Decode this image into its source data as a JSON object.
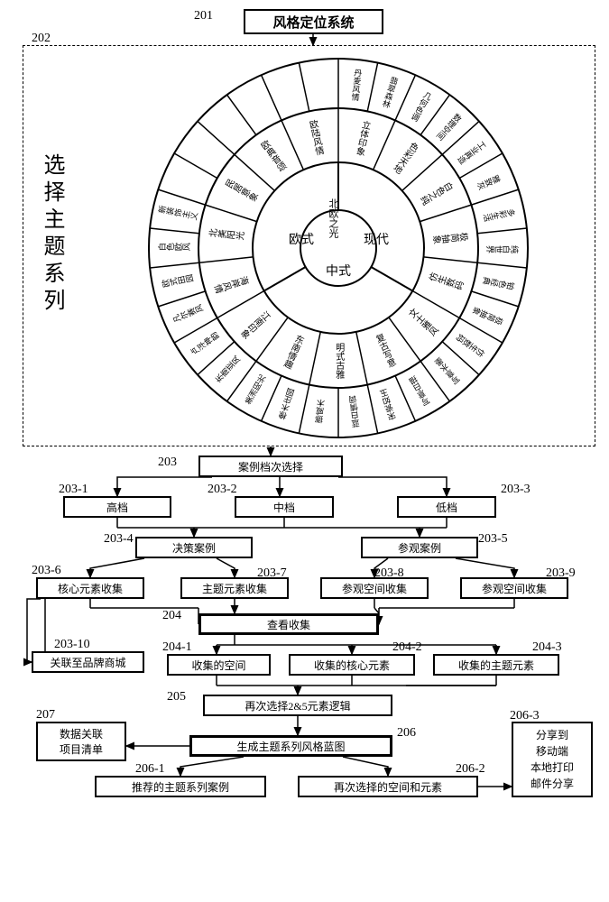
{
  "refs": {
    "r201": "201",
    "r202": "202",
    "r203": "203",
    "r203_1": "203-1",
    "r203_2": "203-2",
    "r203_3": "203-3",
    "r203_4": "203-4",
    "r203_5": "203-5",
    "r203_6": "203-6",
    "r203_7": "203-7",
    "r203_8": "203-8",
    "r203_9": "203-9",
    "r203_10": "203-10",
    "r204": "204",
    "r204_1": "204-1",
    "r204_2": "204-2",
    "r204_3": "204-3",
    "r205": "205",
    "r206": "206",
    "r206_1": "206-1",
    "r206_2": "206-2",
    "r206_3": "206-3",
    "r207": "207"
  },
  "title": "风格定位系统",
  "panel_title": "选择主题系列",
  "sunburst": {
    "center_top": "北欧之光",
    "ring1": [
      "欧式",
      "现代",
      "中式"
    ],
    "ring2_eu": [
      "欧陆风情",
      "欧典音颂",
      "民居意象",
      "北美阳光",
      "海岸风情"
    ],
    "ring2_modern": [
      "立体印象",
      "色彩天地",
      "白色之纯",
      "极简抽象",
      "仿生数码"
    ],
    "ring2_cn": [
      "文士雅风",
      "复古写意",
      "明式古雅",
      "东南情趣",
      "江南印象"
    ],
    "ring3_eu": [
      "新装饰主义",
      "白色欧风",
      "欧式田园",
      "凡尔赛风",
      "卢浮神韵",
      "东南亚风",
      "美洲阳光",
      "橡木庄园",
      "挪威木",
      "蓝白情调"
    ],
    "ring3_modern": [
      "丹麦风情",
      "翡翠森林",
      "几何色调",
      "数理空间",
      "工业再造",
      "雅致灰",
      "多彩生活",
      "纯白世界",
      "铂色经典",
      "极简抽象",
      "仿生数码"
    ],
    "ring3_cn": [
      "写意水墨",
      "写意白描",
      "宋瓷如玉"
    ]
  },
  "flow": {
    "case_grade_select": "案例档次选择",
    "grade_high": "高档",
    "grade_mid": "中档",
    "grade_low": "低档",
    "decision_case": "决策案例",
    "visit_case": "参观案例",
    "core_elem_collect": "核心元素收集",
    "theme_elem_collect": "主题元素收集",
    "visit_space_collect_1": "参观空间收集",
    "visit_space_collect_2": "参观空间收集",
    "view_collect": "查看收集",
    "link_brand_mall": "关联至品牌商城",
    "collected_space": "收集的空间",
    "collected_core": "收集的核心元素",
    "collected_theme": "收集的主题元素",
    "reselect_logic": "再次选择2&5元素逻辑",
    "gen_blueprint": "生成主题系列风格蓝图",
    "recommended_cases": "推荐的主题系列案例",
    "reselect_space_elem": "再次选择的空间和元素",
    "data_link_list": "数据关联\n项目清单",
    "share_panel": "分享到\n移动端\n本地打印\n邮件分享"
  }
}
